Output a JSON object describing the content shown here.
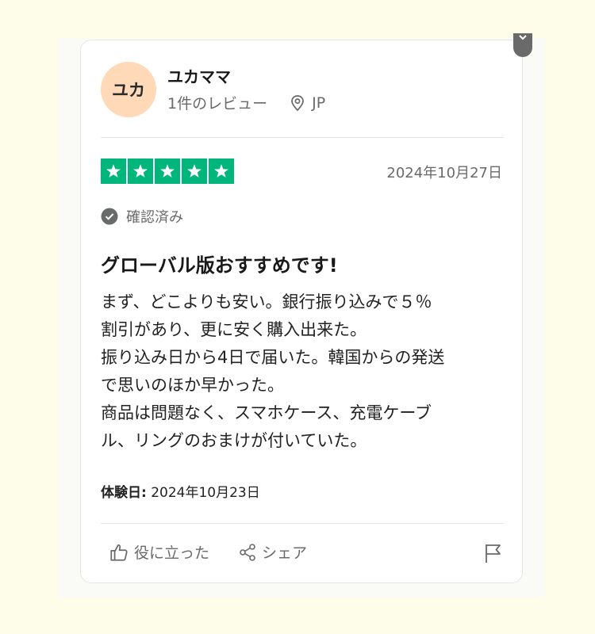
{
  "reviewer": {
    "avatar_initials": "ユカ",
    "avatar_color": "#ffd9b8",
    "name": "ユカママ",
    "review_count": "1件のレビュー",
    "country": "JP"
  },
  "review": {
    "rating": 5,
    "rating_max": 5,
    "star_color": "#00b67a",
    "date": "2024年10月27日",
    "verified_label": "確認済み",
    "title": "グローバル版おすすめです!",
    "body_lines": [
      "まず、どこよりも安い。銀行振り込みで５％",
      "割引があり、更に安く購入出来た。",
      "振り込み日から4日で届いた。韓国からの発送",
      "で思いのほか早かった。",
      "商品は問題なく、スマホケース、充電ケーブ",
      "ル、リングのおまけが付いていた。"
    ],
    "experience_label": "体験日:",
    "experience_date": "2024年10月23日"
  },
  "actions": {
    "helpful_label": "役に立った",
    "share_label": "シェア"
  },
  "icons": {
    "location": "location-pin-icon",
    "verified": "checkmark-circle-icon",
    "helpful": "thumbs-up-icon",
    "share": "share-icon",
    "flag": "flag-icon",
    "corner": "chevron-down-icon"
  }
}
